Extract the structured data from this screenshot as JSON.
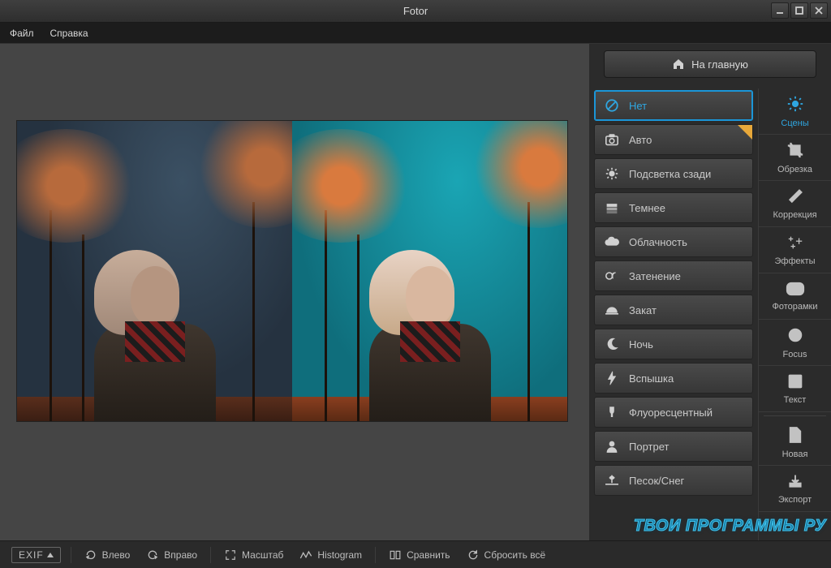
{
  "app": {
    "title": "Fotor"
  },
  "menu": {
    "file": "Файл",
    "help": "Справка"
  },
  "header": {
    "home": "На главную"
  },
  "scenes": {
    "items": [
      {
        "key": "none",
        "label": "Нет",
        "selected": true,
        "star": false
      },
      {
        "key": "auto",
        "label": "Авто",
        "selected": false,
        "star": true
      },
      {
        "key": "backlit",
        "label": "Подсветка сзади",
        "selected": false,
        "star": false
      },
      {
        "key": "darken",
        "label": "Темнее",
        "selected": false,
        "star": false
      },
      {
        "key": "cloudy",
        "label": "Облачность",
        "selected": false,
        "star": false
      },
      {
        "key": "shade",
        "label": "Затенение",
        "selected": false,
        "star": false
      },
      {
        "key": "sunset",
        "label": "Закат",
        "selected": false,
        "star": false
      },
      {
        "key": "night",
        "label": "Ночь",
        "selected": false,
        "star": false
      },
      {
        "key": "flash",
        "label": "Вспышка",
        "selected": false,
        "star": false
      },
      {
        "key": "fluorescent",
        "label": "Флуоресцентный",
        "selected": false,
        "star": false
      },
      {
        "key": "portrait",
        "label": "Портрет",
        "selected": false,
        "star": false
      },
      {
        "key": "sand-snow",
        "label": "Песок/Снег",
        "selected": false,
        "star": false
      }
    ]
  },
  "tools": {
    "items": [
      {
        "key": "scenes",
        "label": "Сцены",
        "selected": true
      },
      {
        "key": "crop",
        "label": "Обрезка",
        "selected": false
      },
      {
        "key": "adjust",
        "label": "Коррекция",
        "selected": false
      },
      {
        "key": "effects",
        "label": "Эффекты",
        "selected": false
      },
      {
        "key": "frames",
        "label": "Фоторамки",
        "selected": false
      },
      {
        "key": "focus",
        "label": "Focus",
        "selected": false
      },
      {
        "key": "text",
        "label": "Текст",
        "selected": false
      },
      {
        "key": "new",
        "label": "Новая",
        "selected": false
      },
      {
        "key": "export",
        "label": "Экспорт",
        "selected": false
      }
    ]
  },
  "bottom": {
    "exif": "EXIF",
    "left": "Влево",
    "right": "Вправо",
    "zoom": "Масштаб",
    "histogram": "Histogram",
    "compare": "Сравнить",
    "reset": "Сбросить всё"
  },
  "watermark": "ТВОИ ПРОГРАММЫ РУ"
}
